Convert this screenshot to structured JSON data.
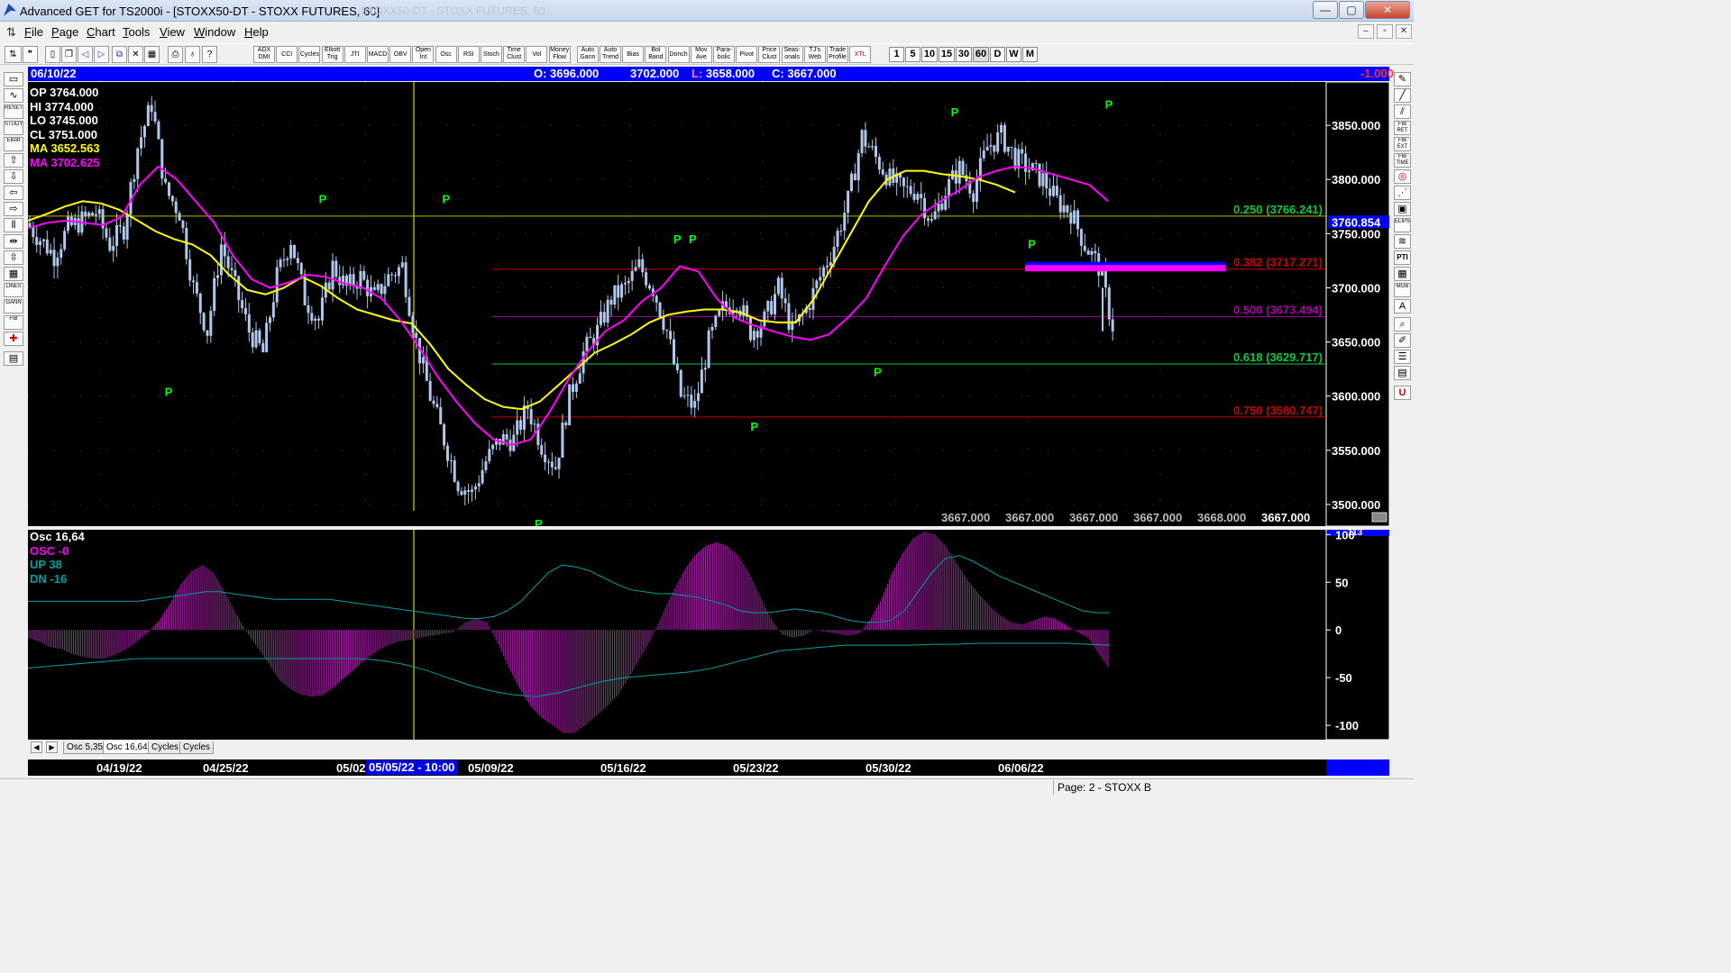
{
  "window": {
    "title": "Advanced GET for TS2000i - [STOXX50-DT - STOXX FUTURES, 60]",
    "faded_title": "STOXX50-DT - STOXX FUTURES, 60",
    "min_label": "—",
    "max_label": "▢",
    "close_label": "✕"
  },
  "menu": {
    "items": [
      "File",
      "Page",
      "Chart",
      "Tools",
      "View",
      "Window",
      "Help"
    ],
    "mdi_min": "–",
    "mdi_restore": "▫",
    "mdi_close": "✕"
  },
  "toolbar": {
    "indicator_buttons": [
      "ADX\nDMI",
      "CCI",
      "Cycles",
      "Elliott\nTrig",
      "JTI",
      "MACD",
      "OBV",
      "Open\nInt",
      "Osc",
      "RSI",
      "Stoch",
      "Time\nClust",
      "Vol",
      "Money\nFlow",
      "Auto\nGann",
      "Auto\nTrend",
      "Bias",
      "Bol\nBand",
      "Donch",
      "Mov\nAve",
      "Para-\nbolic",
      "Pivot",
      "Price\nClust",
      "Seas-\nonals",
      "TJ's\nWeb",
      "Trade\nProfile",
      "XTL"
    ],
    "timeframes": [
      "1",
      "5",
      "10",
      "15",
      "30",
      "60",
      "D",
      "W",
      "M"
    ],
    "active_timeframe": "60"
  },
  "left_tools": [
    "RESET",
    "STUDY",
    "Elliott",
    "LINES",
    "GANN",
    "FIB"
  ],
  "right_tools": [
    "FIB\nRET",
    "FIB\nEXT",
    "FIB\nTIME",
    "ELIPS",
    "PTI",
    "MOB"
  ],
  "infobar": {
    "date": "06/10/22",
    "open": "O: 3696.000",
    "high": "3702.000",
    "low": "L: 3658.000",
    "close": "C: 3667.000",
    "change": "-1.000"
  },
  "legend": {
    "op": "OP  3764.000",
    "hi": "HI   3774.000",
    "lo": "LO  3745.000",
    "cl": "CL  3751.000",
    "ma1": "MA  3652.563",
    "ma2": "MA  3702.625"
  },
  "osc_legend": {
    "name": "Osc 16,64",
    "osc": "OSC -0",
    "up": "UP   38",
    "dn": "DN   -16"
  },
  "colors": {
    "candle": "#b0c8ec",
    "ma_yellow": "#ffff00",
    "ma_magenta": "#ff00ff",
    "pivot": "#00ff00",
    "fib_green": "#00cc44",
    "fib_red": "#cc0000",
    "fib_purple": "#aa00aa",
    "band_cyan": "#00a0a0",
    "hist": "#a020a0"
  },
  "chart_data": [
    {
      "type": "candlestick",
      "title": "",
      "ylim": [
        3480,
        3890
      ],
      "yticks": [
        3500,
        3550,
        3600,
        3650,
        3700,
        3750,
        3800,
        3850
      ],
      "ytick_labels": [
        "3500.000",
        "3550.000",
        "3600.000",
        "3650.000",
        "3700.000",
        "3750.000",
        "3800.000",
        "3850.000"
      ],
      "price_tag": "3760.854",
      "fib_levels": [
        {
          "ratio": "0.250",
          "value": 3766.241,
          "label": "0.250 (3766.241)",
          "color": "#00cc44"
        },
        {
          "ratio": "0.382",
          "value": 3717.271,
          "label": "0.382 (3717.271)",
          "color": "#cc0000"
        },
        {
          "ratio": "0.500",
          "value": 3673.494,
          "label": "0.500 (3673.494)",
          "color": "#aa00aa"
        },
        {
          "ratio": "0.618",
          "value": 3629.717,
          "label": "0.618 (3629.717)",
          "color": "#00cc44"
        },
        {
          "ratio": "0.750",
          "value": 3580.747,
          "label": "0.750 (3580.747)",
          "color": "#cc0000"
        }
      ],
      "pivot_label": "P",
      "pivots": [
        {
          "bar": 9,
          "price": 3612,
          "side": "low"
        },
        {
          "bar": 19,
          "price": 3775,
          "side": "high"
        },
        {
          "bar": 27,
          "price": 3775,
          "side": "high"
        },
        {
          "bar": 33,
          "price": 3490,
          "side": "low"
        },
        {
          "bar": 42,
          "price": 3738,
          "side": "high"
        },
        {
          "bar": 43,
          "price": 3738,
          "side": "high"
        },
        {
          "bar": 47,
          "price": 3580,
          "side": "low"
        },
        {
          "bar": 55,
          "price": 3630,
          "side": "low"
        },
        {
          "bar": 60,
          "price": 3855,
          "side": "high"
        },
        {
          "bar": 65,
          "price": 3748,
          "side": "low"
        },
        {
          "bar": 70,
          "price": 3862,
          "side": "high"
        }
      ],
      "close_path": [
        3760,
        3745,
        3730,
        3755,
        3762,
        3770,
        3740,
        3755,
        3830,
        3870,
        3790,
        3770,
        3700,
        3660,
        3740,
        3700,
        3660,
        3640,
        3710,
        3745,
        3690,
        3670,
        3720,
        3700,
        3710,
        3690,
        3710,
        3720,
        3650,
        3600,
        3560,
        3520,
        3510,
        3540,
        3560,
        3560,
        3590,
        3555,
        3535,
        3600,
        3640,
        3660,
        3690,
        3700,
        3720,
        3700,
        3660,
        3600,
        3590,
        3650,
        3680,
        3690,
        3660,
        3670,
        3700,
        3660,
        3680,
        3710,
        3740,
        3780,
        3840,
        3820,
        3800,
        3790,
        3790,
        3760,
        3790,
        3810,
        3790,
        3830,
        3840,
        3820,
        3810,
        3800,
        3780,
        3770,
        3740,
        3720,
        3665
      ],
      "ma_yellow": [
        3762,
        3768,
        3775,
        3780,
        3778,
        3772,
        3762,
        3752,
        3745,
        3740,
        3730,
        3712,
        3698,
        3694,
        3700,
        3710,
        3702,
        3690,
        3680,
        3675,
        3670,
        3667,
        3648,
        3625,
        3610,
        3597,
        3590,
        3588,
        3595,
        3610,
        3625,
        3640,
        3648,
        3657,
        3668,
        3675,
        3678,
        3680,
        3680,
        3677,
        3670,
        3668,
        3668,
        3690,
        3720,
        3750,
        3780,
        3800,
        3808,
        3808,
        3805,
        3803,
        3800,
        3795,
        3788
      ],
      "ma_magenta": [
        3755,
        3760,
        3762,
        3760,
        3758,
        3765,
        3795,
        3812,
        3800,
        3780,
        3760,
        3730,
        3708,
        3700,
        3705,
        3712,
        3710,
        3704,
        3700,
        3690,
        3670,
        3645,
        3618,
        3595,
        3575,
        3560,
        3555,
        3560,
        3585,
        3615,
        3640,
        3660,
        3670,
        3688,
        3700,
        3720,
        3715,
        3690,
        3672,
        3665,
        3660,
        3655,
        3652,
        3657,
        3672,
        3690,
        3720,
        3748,
        3768,
        3780,
        3790,
        3802,
        3808,
        3812,
        3810,
        3805,
        3800,
        3795,
        3780
      ],
      "bottom_values": [
        "3667.000",
        "3667.000",
        "3667.000",
        "3667.000",
        "3668.000",
        "3667.000"
      ]
    },
    {
      "type": "bar",
      "title": "Osc 16,64",
      "ylim": [
        -115,
        105
      ],
      "yticks": [
        100,
        50,
        0,
        -50,
        -100
      ],
      "ytick_labels": [
        "100",
        "50",
        "0",
        "-50",
        "-100"
      ],
      "top_label": "113",
      "osc_values": [
        -8,
        -12,
        -18,
        -20,
        -25,
        -28,
        -30,
        -30,
        -26,
        -20,
        -12,
        -2,
        10,
        28,
        48,
        62,
        68,
        60,
        40,
        18,
        -2,
        -18,
        -35,
        -52,
        -62,
        -68,
        -70,
        -68,
        -60,
        -50,
        -40,
        -30,
        -22,
        -16,
        -12,
        -10,
        -8,
        -6,
        -4,
        -2,
        8,
        12,
        8,
        -15,
        -40,
        -62,
        -80,
        -92,
        -100,
        -108,
        -108,
        -100,
        -90,
        -80,
        -68,
        -50,
        -30,
        -10,
        15,
        40,
        62,
        78,
        88,
        92,
        88,
        78,
        60,
        35,
        12,
        -5,
        -8,
        -6,
        0,
        -2,
        -4,
        -6,
        -4,
        10,
        30,
        58,
        80,
        96,
        103,
        100,
        88,
        70,
        52,
        38,
        25,
        15,
        8,
        6,
        10,
        14,
        12,
        5,
        -2,
        -8,
        -25,
        -42
      ],
      "up_band": [
        30,
        30,
        30,
        30,
        30,
        30,
        30,
        30,
        30,
        32,
        34,
        36,
        38,
        40,
        40,
        38,
        36,
        34,
        32,
        32,
        32,
        32,
        32,
        30,
        28,
        26,
        24,
        22,
        20,
        18,
        16,
        14,
        12,
        12,
        14,
        20,
        30,
        45,
        60,
        68,
        66,
        62,
        55,
        48,
        42,
        40,
        38,
        38,
        36,
        34,
        30,
        26,
        20,
        18,
        18,
        20,
        22,
        20,
        18,
        14,
        10,
        8,
        8,
        10,
        20,
        40,
        60,
        75,
        78,
        72,
        64,
        56,
        50,
        44,
        38,
        32,
        26,
        20,
        18,
        18
      ],
      "dn_band": [
        -40,
        -38,
        -36,
        -34,
        -32,
        -30,
        -30,
        -30,
        -30,
        -30,
        -30,
        -30,
        -30,
        -30,
        -30,
        -30,
        -32,
        -36,
        -42,
        -50,
        -58,
        -64,
        -68,
        -70,
        -66,
        -60,
        -54,
        -50,
        -48,
        -46,
        -44,
        -40,
        -34,
        -28,
        -22,
        -20,
        -18,
        -16,
        -16,
        -16,
        -16,
        -15,
        -15,
        -14,
        -14,
        -14,
        -14,
        -14,
        -15,
        -16
      ]
    }
  ],
  "tabs": {
    "left_arrow": "◀",
    "right_arrow": "▶",
    "items": [
      "Osc 5,35",
      "Osc 16,64",
      "Cycles",
      "Cycles"
    ],
    "active": "Osc 16,64"
  },
  "dates": {
    "labels": [
      "04/19/22",
      "04/25/22",
      "05/02",
      "05/09/22",
      "05/16/22",
      "05/23/22",
      "05/30/22",
      "06/06/22"
    ],
    "selected": "05/05/22 - 10:00"
  },
  "status": {
    "page": "Page: 2 - STOXX B"
  }
}
